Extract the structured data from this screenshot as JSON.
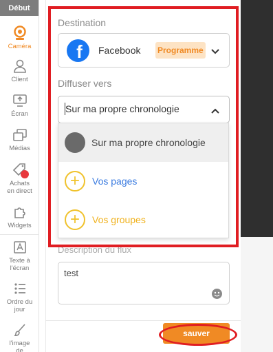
{
  "sidebar": {
    "top_label": "Début",
    "items": [
      {
        "label": "Caméra",
        "icon": "camera-icon"
      },
      {
        "label": "Client",
        "icon": "user-icon"
      },
      {
        "label": "Écran",
        "icon": "screen-share-icon"
      },
      {
        "label": "Médias",
        "icon": "media-icon"
      },
      {
        "label": "Achats\nen direct",
        "icon": "shopping-tag-icon"
      },
      {
        "label": "Widgets",
        "icon": "puzzle-icon"
      },
      {
        "label": "Texte à\nl'écran",
        "icon": "text-icon"
      },
      {
        "label": "Ordre du\njour",
        "icon": "list-icon"
      },
      {
        "label": "l'image\nde",
        "icon": "brush-icon"
      }
    ]
  },
  "form": {
    "destination_label": "Destination",
    "destination_value": "Facebook",
    "destination_badge": "Programme",
    "broadcast_label": "Diffuser vers",
    "broadcast_value": "Sur ma propre chronologie",
    "options": [
      {
        "label": "Sur ma propre chronologie"
      },
      {
        "label": "Vos pages"
      },
      {
        "label": "Vos groupes"
      }
    ],
    "description_label": "Description du flux",
    "description_value": "test",
    "save_label": "sauver"
  },
  "colors": {
    "accent": "#f08a24",
    "facebook": "#1877f2",
    "annotation": "#e01d22",
    "pages_link": "#3a7be0",
    "groups_link": "#f0b21e"
  }
}
